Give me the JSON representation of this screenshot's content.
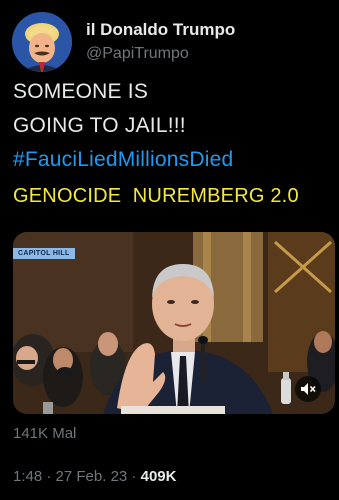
{
  "tweet": {
    "display_name": "il Donaldo Trumpo",
    "handle": "@PapiTrumpo",
    "line1": "SOMEONE IS",
    "line2": "GOING TO JAIL!!!",
    "hashtag": "#FauciLiedMillionsDied",
    "highlight": "GENOCIDE  NUREMBERG 2.0"
  },
  "media": {
    "caption_label": "CAPITOL HILL",
    "mute_icon": "speaker-muted-icon"
  },
  "stats": {
    "views_label": "141K Mal",
    "time": "1:48",
    "sep1": " · ",
    "date": "27 Feb. 23",
    "sep2": " · ",
    "views_count": "409K"
  },
  "colors": {
    "background": "#000000",
    "hashtag": "#1d9bf0",
    "highlight": "#f4e83a",
    "secondary_text": "#71767b"
  }
}
